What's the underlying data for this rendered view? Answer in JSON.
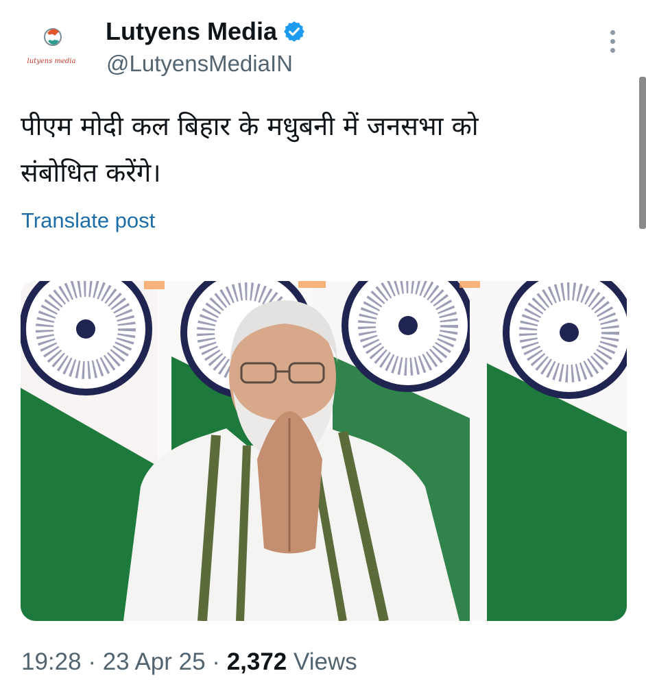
{
  "author": {
    "display_name": "Lutyens Media",
    "handle": "@LutyensMediaIN",
    "avatar_caption": "lutyens media",
    "verified": true
  },
  "post": {
    "text": "पीएम मोदी कल बिहार के मधुबनी में जनसभा को\nसंबोधित करेंगे।",
    "translate_label": "Translate post",
    "time": "19:28",
    "date": "23 Apr 25",
    "separator": "·",
    "views_count": "2,372",
    "views_label": "Views"
  },
  "colors": {
    "accent_blue": "#1d9bf0",
    "link_blue": "#1d6ea8",
    "secondary_text": "#536471",
    "saffron": "#f6a15a",
    "flag_green": "#1e7a3c",
    "chakra_navy": "#1f2450"
  },
  "icons": {
    "verified": "verified-badge-icon",
    "more": "more-options-icon"
  }
}
